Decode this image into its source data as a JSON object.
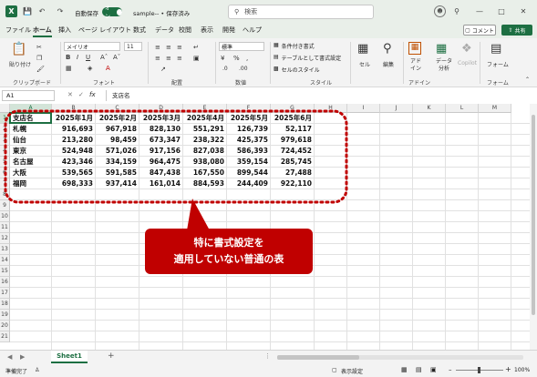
{
  "titlebar": {
    "autosave_label": "自動保存",
    "autosave_state": "オン",
    "doc_title": "sample-- • 保存済み",
    "search_placeholder": "検索"
  },
  "menu": [
    "ファイル",
    "ホーム",
    "挿入",
    "ページ レイアウト",
    "数式",
    "データ",
    "校閲",
    "表示",
    "開発",
    "ヘルプ"
  ],
  "menu_active": "ホーム",
  "menu_right": {
    "comments": "コメント",
    "share": "共有"
  },
  "ribbon": {
    "paste": "貼り付け",
    "font_name": "メイリオ",
    "font_size": "11",
    "number_format": "標準",
    "conditional_format": "条件付き書式",
    "format_as_table": "テーブルとして書式設定",
    "cell_styles": "セルのスタイル",
    "cell": "セル",
    "editing": "編集",
    "addin": "アド イン",
    "data_analysis": "データ 分析",
    "copilot": "Copilot",
    "form": "フォーム",
    "groups": [
      "クリップボード",
      "フォント",
      "配置",
      "数値",
      "スタイル",
      "アドイン",
      "フォーム"
    ]
  },
  "formula_bar": {
    "name_box": "A1",
    "fx": "fx",
    "content": "支店名"
  },
  "grid": {
    "columns": [
      "A",
      "B",
      "C",
      "D",
      "E",
      "F",
      "G",
      "H",
      "I",
      "J",
      "K",
      "L",
      "M"
    ],
    "rows": [
      "1",
      "2",
      "3",
      "4",
      "5",
      "6",
      "7",
      "8",
      "9",
      "10",
      "11",
      "12",
      "13",
      "14",
      "15",
      "16",
      "17",
      "18",
      "19",
      "20",
      "21"
    ],
    "headers": [
      "支店名",
      "2025年1月",
      "2025年2月",
      "2025年3月",
      "2025年4月",
      "2025年5月",
      "2025年6月"
    ],
    "data": [
      [
        "札幌",
        "916,693",
        "967,918",
        "828,130",
        "551,291",
        "126,739",
        "52,117"
      ],
      [
        "仙台",
        "213,280",
        "98,459",
        "673,347",
        "238,322",
        "425,375",
        "979,618"
      ],
      [
        "東京",
        "524,948",
        "571,026",
        "917,156",
        "827,038",
        "586,393",
        "724,452"
      ],
      [
        "名古屋",
        "423,346",
        "334,159",
        "964,475",
        "938,080",
        "359,154",
        "285,745"
      ],
      [
        "大阪",
        "539,565",
        "591,585",
        "847,438",
        "167,550",
        "899,544",
        "27,488"
      ],
      [
        "福岡",
        "698,333",
        "937,414",
        "161,014",
        "884,593",
        "244,409",
        "922,110"
      ]
    ]
  },
  "sheet_tabs": [
    "Sheet1"
  ],
  "status": {
    "ready": "準備完了",
    "display_settings": "表示設定",
    "zoom": "100%"
  },
  "callout": {
    "line1": "特に書式設定を",
    "line2": "適用していない普通の表"
  },
  "colors": {
    "excel_green": "#1d6f42",
    "callout_red": "#c00000"
  }
}
